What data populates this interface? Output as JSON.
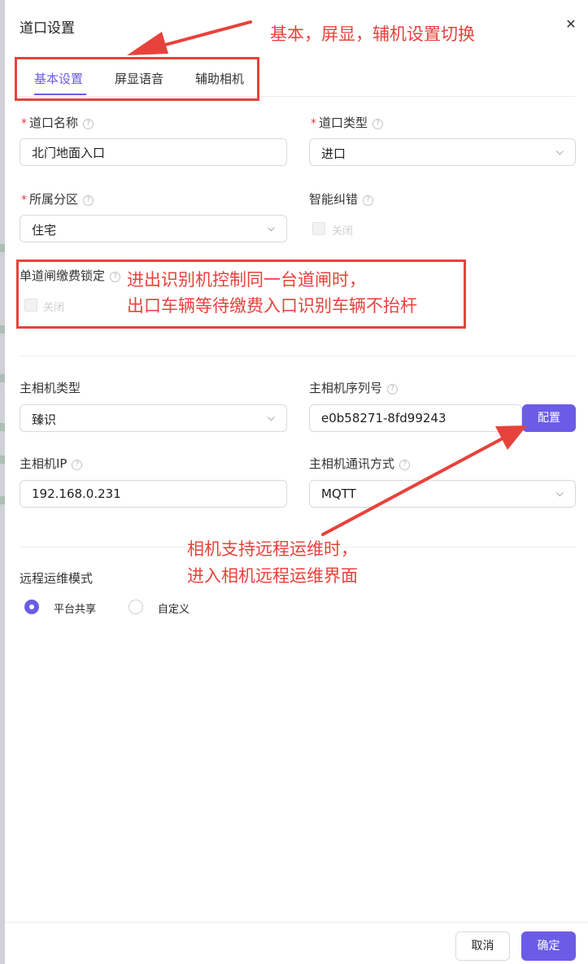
{
  "dialog": {
    "title": "道口设置",
    "close_icon": "✕"
  },
  "tabs": [
    {
      "label": "基本设置",
      "active": true
    },
    {
      "label": "屏显语音",
      "active": false
    },
    {
      "label": "辅助相机",
      "active": false
    }
  ],
  "form": {
    "lane_name": {
      "label": "道口名称",
      "required": true,
      "value": "北门地面入口"
    },
    "lane_type": {
      "label": "道口类型",
      "required": true,
      "value": "进口"
    },
    "zone": {
      "label": "所属分区",
      "required": true,
      "value": "住宅"
    },
    "smart_correct": {
      "label": "智能纠错",
      "toggle_label": "关闭"
    },
    "single_lane_lock": {
      "label": "单道闸缴费锁定",
      "toggle_label": "关闭"
    },
    "camera_type": {
      "label": "主相机类型",
      "value": "臻识"
    },
    "camera_serial": {
      "label": "主相机序列号",
      "value": "e0b58271-8fd99243",
      "config_button": "配置"
    },
    "camera_ip": {
      "label": "主相机IP",
      "value": "192.168.0.231"
    },
    "camera_comm": {
      "label": "主相机通讯方式",
      "value": "MQTT"
    },
    "remote_mode": {
      "label": "远程运维模式",
      "options": [
        {
          "label": "平台共享",
          "selected": true
        },
        {
          "label": "自定义",
          "selected": false
        }
      ]
    }
  },
  "footer": {
    "cancel": "取消",
    "confirm": "确定"
  },
  "annotations": {
    "tabs_note": "基本，屏显，辅机设置切换",
    "lock_note_line1": "进出识别机控制同一台道闸时，",
    "lock_note_line2": "出口车辆等待缴费入口识别车辆不抬杆",
    "camera_note_line1": "相机支持远程运维时，",
    "camera_note_line2": "进入相机远程运维界面",
    "color": "#e8423c"
  },
  "colors": {
    "accent": "#6b5ce7",
    "required": "#e23a3a"
  },
  "icons": {
    "help": "?",
    "chevron": "⌵"
  }
}
